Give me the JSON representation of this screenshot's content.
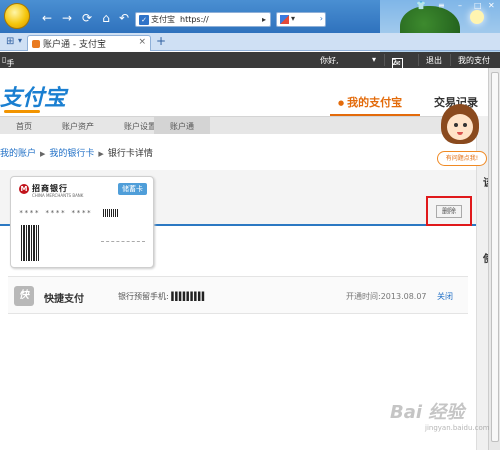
{
  "browser": {
    "address_site": "支付宝",
    "address_url": "https://",
    "tab_title": "账户通 - 支付宝"
  },
  "topbar": {
    "mobile_alipay": "手机支付宝",
    "greeting": "你好,",
    "message_count": "2",
    "logout": "退出",
    "my_alipay": "我的支付"
  },
  "header": {
    "brand": "支付宝",
    "nav_my_alipay": "我的支付宝",
    "nav_transactions": "交易记录"
  },
  "subnav": {
    "items": [
      "首页",
      "账户资产",
      "账户设置",
      "账户通"
    ]
  },
  "breadcrumb": {
    "level1": "我的账户",
    "level2": "我的银行卡",
    "level3": "银行卡详情"
  },
  "card": {
    "bank_name": "招商银行",
    "bank_name_en": "CHINA MERCHANTS BANK",
    "type": "储蓄卡",
    "number_masked": "**** **** ****"
  },
  "delete_label": "删除",
  "quick_pay": {
    "icon_char": "快",
    "title": "快捷支付",
    "phone_label": "银行预留手机:",
    "opened_label": "开通时间:",
    "opened_date": "2013.08.07",
    "close_label": "关闭"
  },
  "side": {
    "help_text": "有问题点我!",
    "char1": "该",
    "char2": "使"
  },
  "watermark": {
    "text": "Bai 经验",
    "url": "jingyan.baidu.com"
  },
  "colors": {
    "accent_orange": "#e36b0b",
    "link_blue": "#1f6fc6",
    "highlight_red": "#e0191b"
  }
}
